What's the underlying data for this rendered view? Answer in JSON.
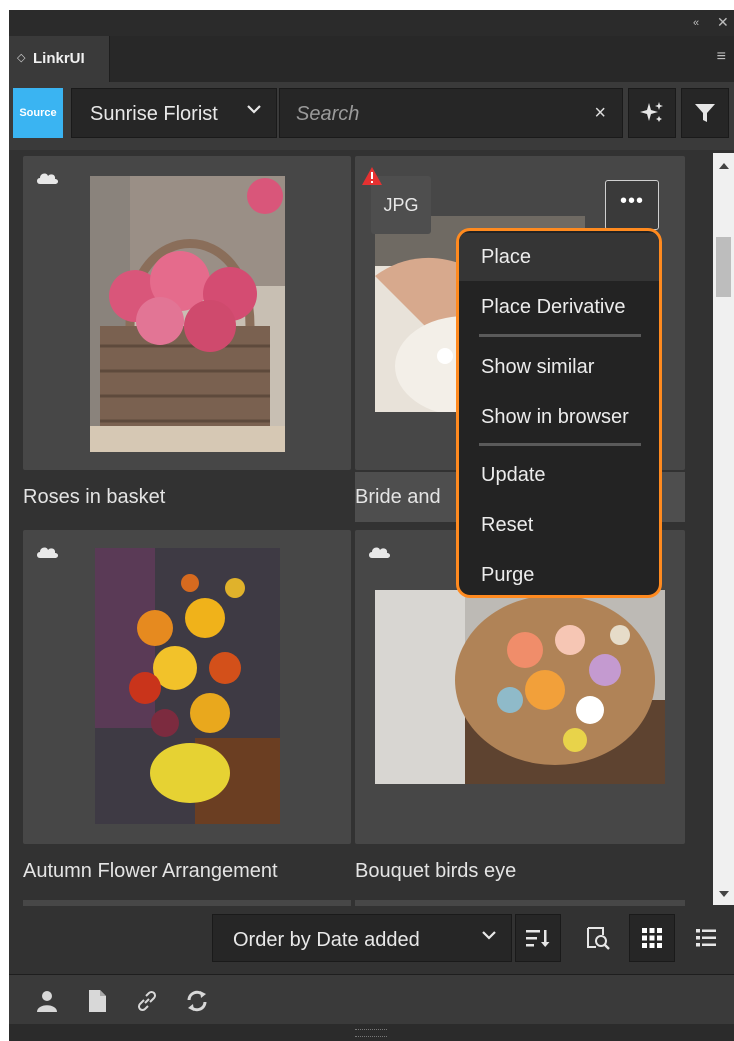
{
  "panel": {
    "tab_label": "LinkrUI",
    "tab_prefix": "◇",
    "collapse_glyph": "«",
    "close_glyph": "✕",
    "menu_glyph": "≡"
  },
  "toolbar": {
    "source_label": "Source",
    "brand_value": "Sunrise Florist",
    "search_placeholder": "Search",
    "clear_glyph": "×",
    "ai_icon": "sparkle-icon",
    "filter_icon": "filter-icon"
  },
  "assets": [
    {
      "title": "Roses in basket",
      "cloud": true
    },
    {
      "title": "Bride and",
      "badge": "JPG",
      "warning": true,
      "more_glyph": "•••"
    },
    {
      "title": "Autumn Flower Arrangement",
      "cloud": true
    },
    {
      "title": "Bouquet birds eye",
      "cloud": true
    }
  ],
  "context_menu": {
    "items": [
      "Place",
      "Place Derivative",
      "Show similar",
      "Show in browser",
      "Update",
      "Reset",
      "Purge"
    ],
    "highlight_color": "#ff8a1f"
  },
  "bottom": {
    "order_label": "Order by Date added",
    "sort_icon": "sort-icon",
    "preview_icon": "preview-icon",
    "grid_icon": "grid-view-icon",
    "list_icon": "list-view-icon"
  },
  "footer": {
    "icons": [
      "user-icon",
      "file-icon",
      "link-icon",
      "refresh-icon"
    ]
  },
  "colors": {
    "source_badge": "#3ab4f2",
    "panel_bg": "#323232",
    "menu_border": "#ff8a1f"
  }
}
